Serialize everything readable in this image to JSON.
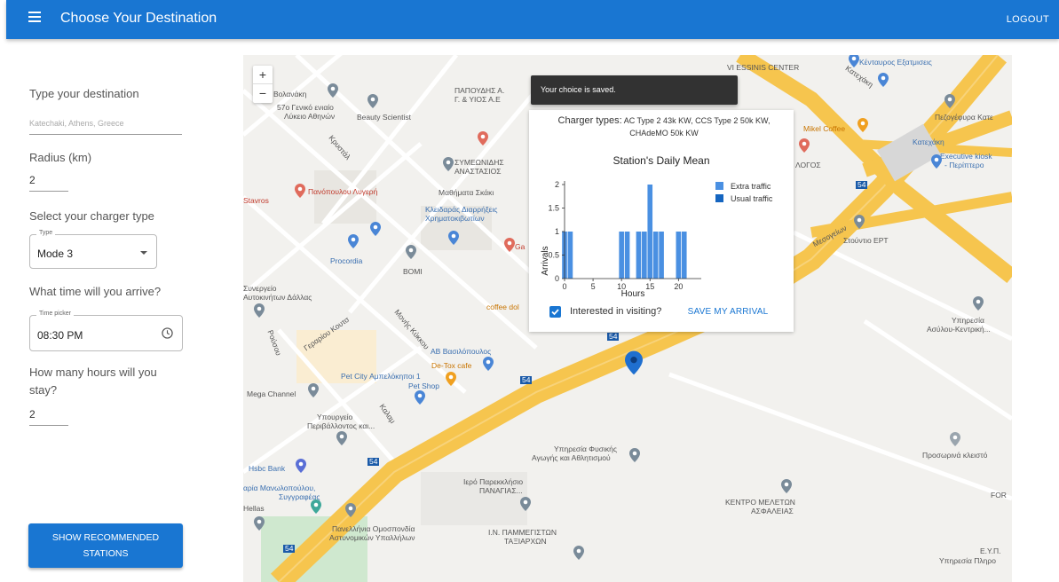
{
  "appbar": {
    "title": "Choose Your Destination",
    "logout": "LOGOUT"
  },
  "form": {
    "destination_label": "Type your destination",
    "destination_value": "Katechaki, Athens, Greece",
    "radius_label": "Radius (km)",
    "radius_value": "2",
    "charger_label": "Select your charger type",
    "type_legend": "Type",
    "type_value": "Mode 3",
    "arrival_label": "What time will you arrive?",
    "time_legend": "Time picker",
    "time_value": "08:30 PM",
    "stay_label": "How many hours will you stay?",
    "stay_value": "2",
    "show_button": "SHOW RECOMMENDED STATIONS"
  },
  "map": {
    "zoom_in": "+",
    "zoom_out": "−",
    "labels": [
      "Βολανάκη",
      "57ο Γενικό ενιαίο",
      "Λύκειο Αθηνών",
      "Beauty Scientist",
      "ΠΑΠΟΥΔΗΣ Α.",
      "Γ. & ΥΙΟΣ Α.Ε",
      "ΣΥΜΕΩΝΙΔΗΣ",
      "ΑΝΑΣΤΑΣΙΟΣ",
      "Πανόπουλου Λυγερή",
      "Μαθήματα Σκάκι",
      "Κλειδαράς Διαρρήξεις",
      "Χρηματοκιβωτίων",
      "Procordia",
      "ΒΟΜΙ",
      "Stavros",
      "Συνεργείο",
      "Αυτοκινήτων Δάλλας",
      "coffee dol",
      "ΑΒ Βασιλόπουλος",
      "De-Tox cafe",
      "Pet City Αμπελόκηποι 1",
      "Pet Shop",
      "Mega Channel",
      "Υπουργείο",
      "Περιβάλλοντος και...",
      "Hsbc Bank",
      "αρία Μανωλοπούλου,",
      "Συγγραφέας",
      "Hellas",
      "Πανελλήνια Ομοσπονδία",
      "Αστυνομικών Υπαλλήλων",
      "Ιερό Παρεκκλήσιο",
      "ΠΑΝΑΓΙΑΣ...",
      "Ι.Ν. ΠΑΜΜΕΓΙΣΤΩΝ",
      "ΤΑΞΙΑΡΧΩΝ",
      "Υπηρεσία Φυσικής",
      "Αγωγής και Αθλητισμού",
      "ΚΕΝΤΡΟ ΜΕΛΕΤΩΝ",
      "ΑΣΦΑΛΕΙΑΣ",
      "Κένταυρος Εξατμισεις",
      "Mikel Coffee",
      "Κατεχάκη",
      "Πεζογέφυρα Κατε",
      "Executive kiosk",
      "- Περίπτερο",
      "Στούντιο ΕΡΤ",
      "Υπηρεσία",
      "Ασύλου-Κεντρική...",
      "Προσωρινά κλειστό",
      "Ε.Υ.Π.",
      "Υπηρεσία Πληρο",
      "FOR",
      "VI ESSINIS CENTER",
      "ΛΟΓΟΣ",
      "Κατεχάκη",
      "Μεσογείων",
      "Γεραρίου Κουτσ",
      "Μονής Κύκκου",
      "Κρυστάλ",
      "Καλαμ",
      "Ρούσου",
      "54",
      "54",
      "54",
      "54",
      "54",
      "Ga"
    ]
  },
  "toast": "Your choice is saved.",
  "popup": {
    "charger_prefix": "Charger types:",
    "charger_types": "AC Type 2 43k KW, CCS Type 2 50k KW, CHAdeMO 50k KW",
    "visit_label": "Interested in visiting?",
    "save_button": "SAVE MY ARRIVAL"
  },
  "colors": {
    "primary": "#1976d2",
    "extra_traffic": "#4a90e2",
    "usual_traffic": "#1565c0",
    "road_yellow": "#f6c54e"
  },
  "chart_data": {
    "type": "bar",
    "title": "Station's Daily Mean",
    "xlabel": "Hours",
    "ylabel": "Arrivals",
    "xlim": [
      0,
      24
    ],
    "ylim": [
      0,
      2
    ],
    "x_ticks": [
      0,
      5,
      10,
      15,
      20
    ],
    "y_ticks": [
      0,
      0.5,
      1,
      1.5,
      2
    ],
    "x_tick_labels": [
      "0",
      "5",
      "10",
      "15",
      "20"
    ],
    "y_tick_labels": [
      "0",
      "0.5",
      "1",
      "1.5",
      "2"
    ],
    "legend_position": "top-right",
    "categories": [
      0,
      1,
      2,
      3,
      4,
      5,
      6,
      7,
      8,
      9,
      10,
      11,
      12,
      13,
      14,
      15,
      16,
      17,
      18,
      19,
      20,
      21,
      22,
      23
    ],
    "series": [
      {
        "name": "Extra traffic",
        "values": [
          1,
          1,
          0,
          0,
          0,
          0,
          0,
          0,
          0,
          0,
          1,
          1,
          0,
          1,
          1,
          2,
          1,
          1,
          0,
          0,
          1,
          1,
          0,
          0
        ]
      },
      {
        "name": "Usual traffic",
        "values": [
          0,
          0,
          0,
          0,
          0,
          0,
          0,
          0,
          0,
          0,
          0,
          0,
          0,
          0,
          0,
          0,
          0,
          0,
          0,
          0,
          0,
          0,
          0,
          0
        ]
      }
    ]
  }
}
